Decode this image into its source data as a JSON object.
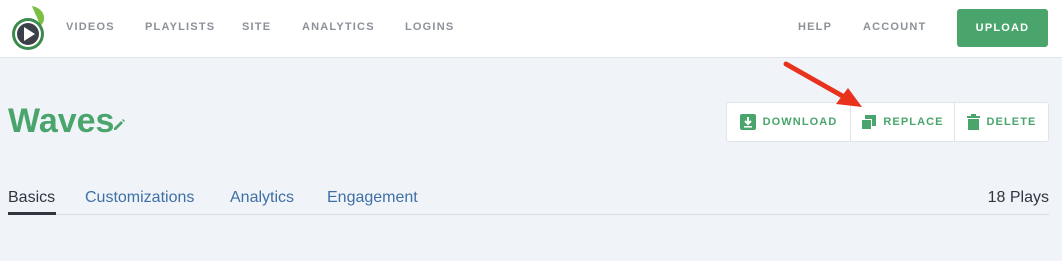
{
  "nav": {
    "items": [
      "VIDEOS",
      "PLAYLISTS",
      "SITE",
      "ANALYTICS",
      "LOGINS"
    ],
    "right_items": [
      "HELP",
      "ACCOUNT"
    ],
    "upload_label": "UPLOAD"
  },
  "video": {
    "title": "Waves",
    "actions": [
      "DOWNLOAD",
      "REPLACE",
      "DELETE"
    ]
  },
  "tabs": [
    "Basics",
    "Customizations",
    "Analytics",
    "Engagement"
  ],
  "plays": "18 Plays",
  "colors": {
    "brand_green": "#4aa56d",
    "link_blue": "#3f6fa5",
    "nav_gray": "#8c9199",
    "annotation_red": "#e8321e",
    "page_bg": "#f0f4f9"
  },
  "icons": [
    "logo-play-icon",
    "pencil-icon",
    "download-icon",
    "replace-icon",
    "trash-icon",
    "red-arrow-annotation"
  ]
}
